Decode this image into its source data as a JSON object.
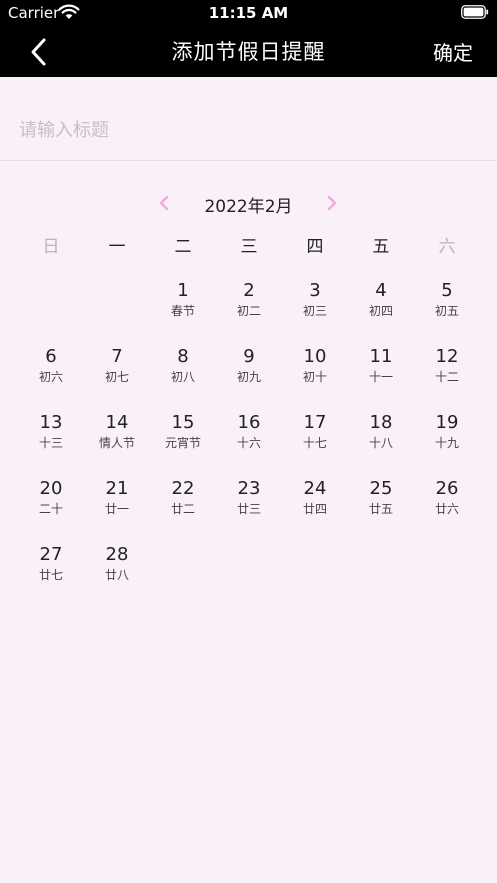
{
  "status_bar": {
    "carrier": "Carrier",
    "time": "11:15 AM"
  },
  "nav": {
    "title": "添加节假日提醒",
    "confirm_label": "确定"
  },
  "title_input": {
    "placeholder": "请输入标题",
    "value": ""
  },
  "calendar": {
    "month_label": "2022年2月",
    "first_weekday_index": 2,
    "weekdays": [
      {
        "label": "日",
        "dim": true
      },
      {
        "label": "一",
        "dim": false
      },
      {
        "label": "二",
        "dim": false
      },
      {
        "label": "三",
        "dim": false
      },
      {
        "label": "四",
        "dim": false
      },
      {
        "label": "五",
        "dim": false
      },
      {
        "label": "六",
        "dim": true
      }
    ],
    "days": [
      {
        "day": "1",
        "lunar": "春节"
      },
      {
        "day": "2",
        "lunar": "初二"
      },
      {
        "day": "3",
        "lunar": "初三"
      },
      {
        "day": "4",
        "lunar": "初四"
      },
      {
        "day": "5",
        "lunar": "初五"
      },
      {
        "day": "6",
        "lunar": "初六"
      },
      {
        "day": "7",
        "lunar": "初七"
      },
      {
        "day": "8",
        "lunar": "初八"
      },
      {
        "day": "9",
        "lunar": "初九"
      },
      {
        "day": "10",
        "lunar": "初十"
      },
      {
        "day": "11",
        "lunar": "十一"
      },
      {
        "day": "12",
        "lunar": "十二"
      },
      {
        "day": "13",
        "lunar": "十三"
      },
      {
        "day": "14",
        "lunar": "情人节"
      },
      {
        "day": "15",
        "lunar": "元宵节"
      },
      {
        "day": "16",
        "lunar": "十六"
      },
      {
        "day": "17",
        "lunar": "十七"
      },
      {
        "day": "18",
        "lunar": "十八"
      },
      {
        "day": "19",
        "lunar": "十九"
      },
      {
        "day": "20",
        "lunar": "二十"
      },
      {
        "day": "21",
        "lunar": "廿一"
      },
      {
        "day": "22",
        "lunar": "廿二"
      },
      {
        "day": "23",
        "lunar": "廿三"
      },
      {
        "day": "24",
        "lunar": "廿四"
      },
      {
        "day": "25",
        "lunar": "廿五"
      },
      {
        "day": "26",
        "lunar": "廿六"
      },
      {
        "day": "27",
        "lunar": "廿七"
      },
      {
        "day": "28",
        "lunar": "廿八"
      }
    ]
  },
  "colors": {
    "background": "#faf0f7",
    "bar": "#000000",
    "month_arrow": "#f5a9d8"
  },
  "icons": {
    "back": "chevron-left-icon",
    "prev": "chevron-left-icon",
    "next": "chevron-right-icon",
    "wifi": "wifi-icon",
    "battery": "battery-icon"
  }
}
